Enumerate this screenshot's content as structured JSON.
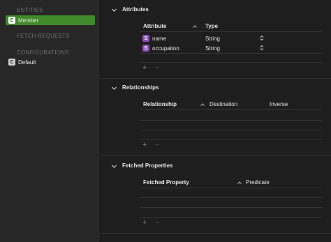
{
  "sidebar": {
    "entities_header": "ENTITIES",
    "entity": {
      "badge": "E",
      "label": "Member"
    },
    "fetch_requests_header": "FETCH REQUESTS",
    "configurations_header": "CONFIGURATIONS",
    "configuration": {
      "badge": "C",
      "label": "Default"
    }
  },
  "attributes": {
    "title": "Attributes",
    "columns": {
      "attribute": "Attribute",
      "type": "Type"
    },
    "rows": [
      {
        "badge": "S",
        "name": "name",
        "type": "String"
      },
      {
        "badge": "S",
        "name": "occupation",
        "type": "String"
      }
    ]
  },
  "relationships": {
    "title": "Relationships",
    "columns": {
      "relationship": "Relationship",
      "destination": "Destination",
      "inverse": "Inverse"
    }
  },
  "fetched_properties": {
    "title": "Fetched Properties",
    "columns": {
      "fetched_property": "Fetched Property",
      "predicate": "Predicate"
    }
  },
  "controls": {
    "add": "+",
    "remove": "−"
  },
  "colors": {
    "selection": "#3f8a2a",
    "string_badge": "#8c4fb8"
  }
}
